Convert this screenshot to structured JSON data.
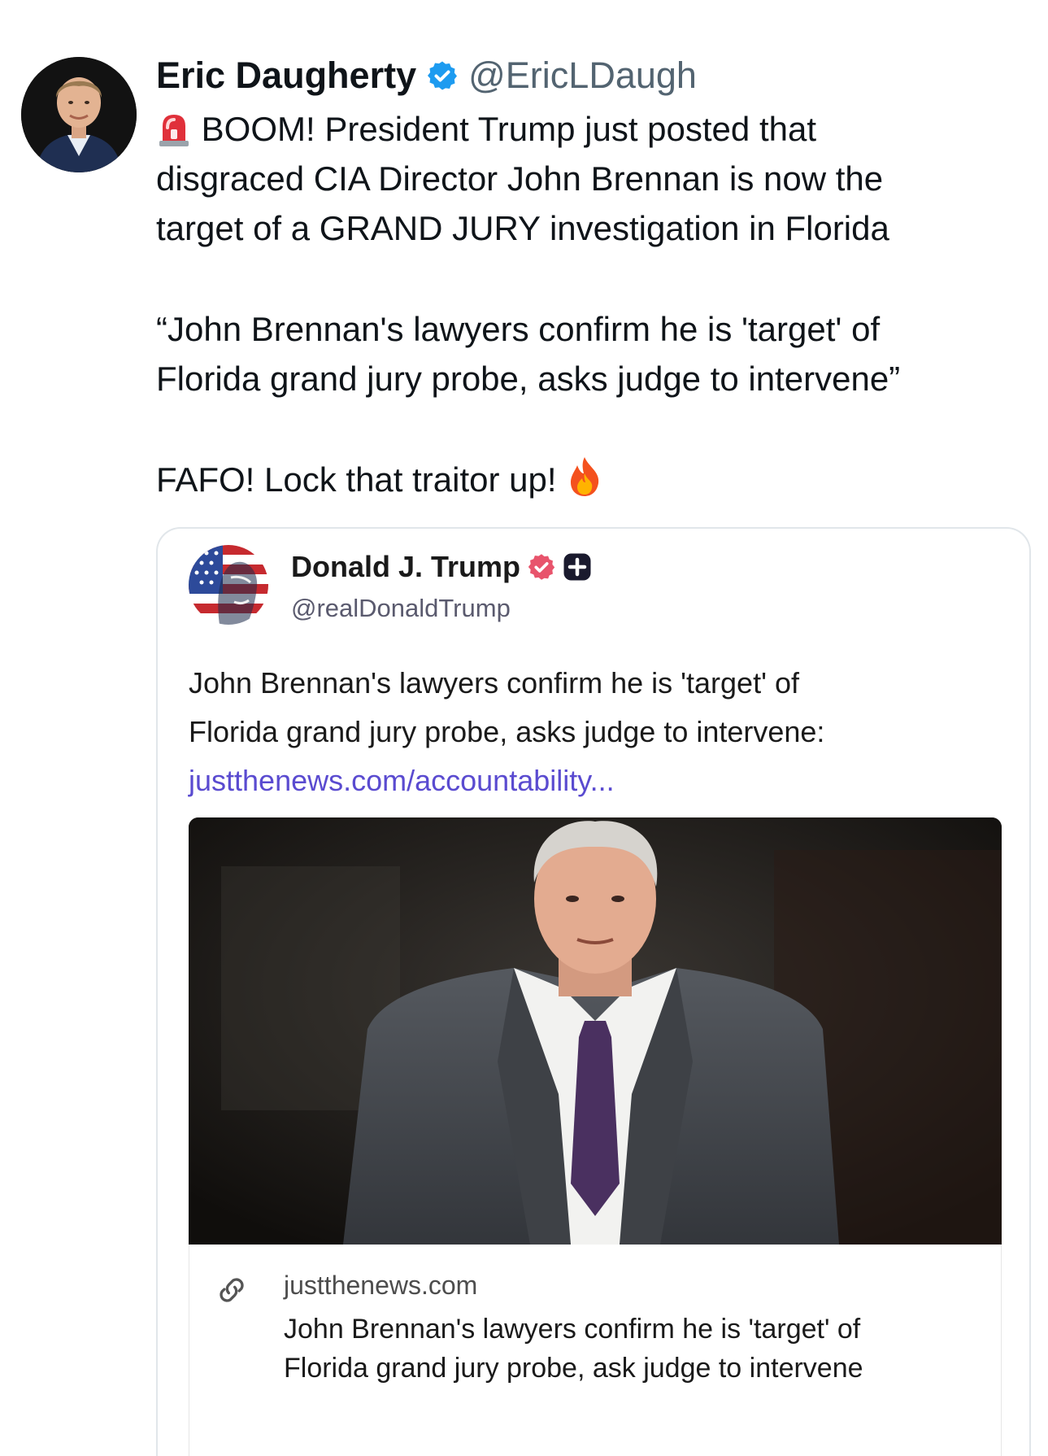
{
  "tweet": {
    "author_name": "Eric Daugherty",
    "author_handle": "@EricLDaugh",
    "lines": [
      "BOOM! President Trump just posted that",
      "disgraced CIA Director John Brennan is now the",
      "target of a GRAND JURY investigation in Florida"
    ],
    "quote_lines": [
      "“John Brennan's lawyers confirm he is 'target' of",
      "Florida grand jury probe, asks judge to intervene”"
    ],
    "closing": "FAFO! Lock that traitor up!",
    "icons": {
      "lead": "police-light-emoji",
      "trail": "fire-emoji",
      "badge": "verified-badge-icon"
    },
    "colors": {
      "verified": "#1d9bf0",
      "text": "#0f1419",
      "handle": "#536471"
    }
  },
  "quoted_post": {
    "author_name": "Donald J. Trump",
    "author_handle": "@realDonaldTrump",
    "body_lines": [
      "John Brennan's lawyers confirm he is 'target' of",
      "Florida grand jury probe, asks judge to intervene:"
    ],
    "link_text": "justthenews.com/accountability...",
    "colors": {
      "verified": "#e8546c",
      "link": "#5a4bd0"
    },
    "link_preview": {
      "domain": "justthenews.com",
      "title_lines": [
        "John Brennan's lawyers confirm he is 'target' of",
        "Florida grand jury probe, ask judge to intervene"
      ]
    }
  }
}
